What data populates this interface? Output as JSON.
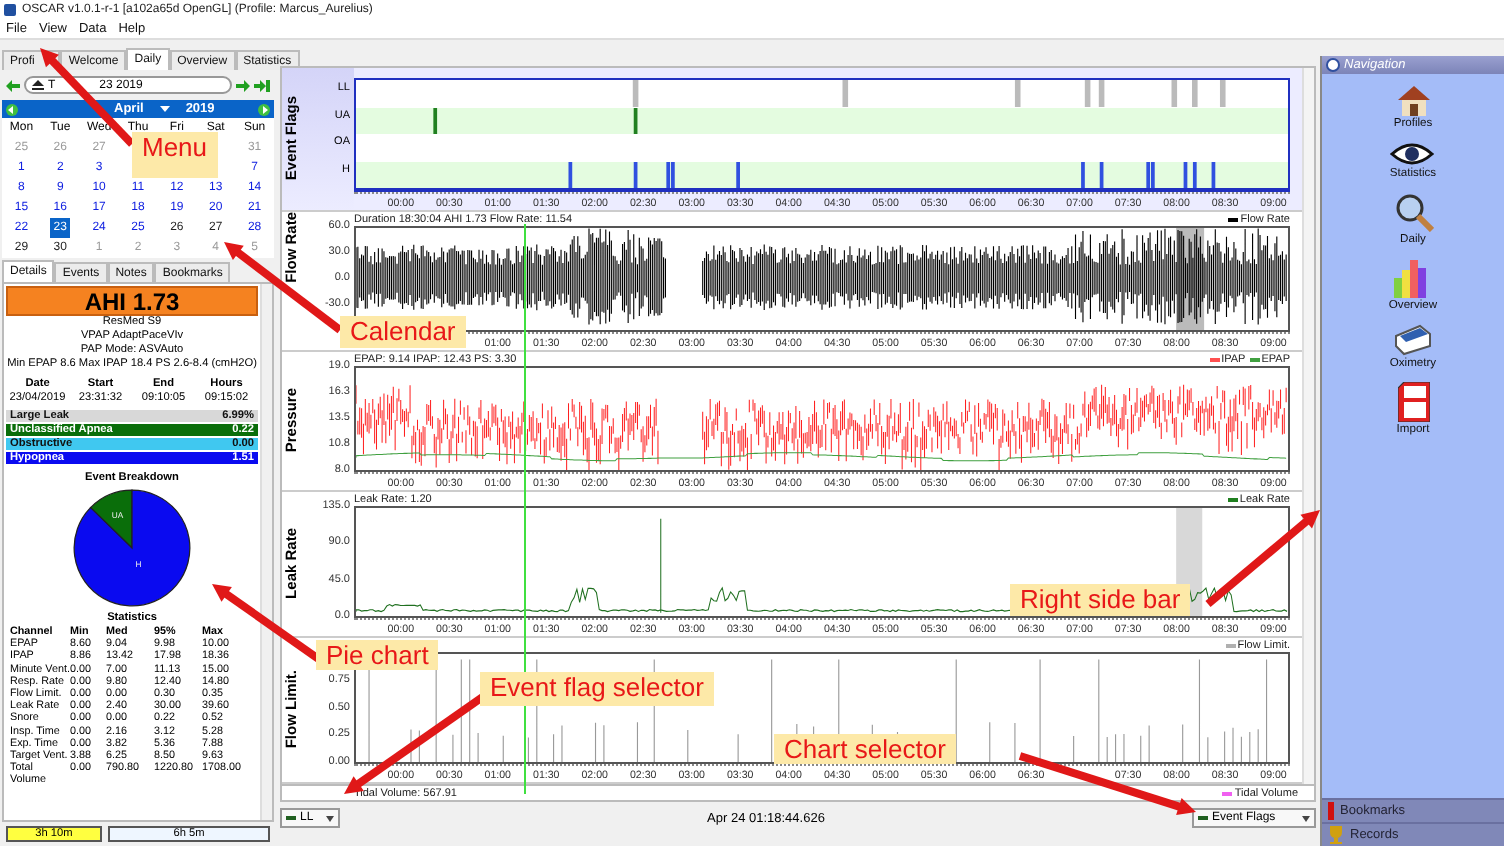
{
  "window": {
    "title": "OSCAR v1.0.1-r-1 [a102a65d OpenGL] (Profile: Marcus_Aurelius)"
  },
  "menu": [
    "File",
    "View",
    "Data",
    "Help"
  ],
  "tabs": [
    {
      "label": "Profi",
      "selected": false
    },
    {
      "label": "Welcome",
      "selected": false
    },
    {
      "label": "Daily",
      "selected": true
    },
    {
      "label": "Overview",
      "selected": false
    },
    {
      "label": "Statistics",
      "selected": false
    }
  ],
  "date_nav": {
    "value_parts": [
      "T",
      "23 2019"
    ]
  },
  "calendar": {
    "month": "April",
    "year": "2019",
    "weekdays": [
      "Mon",
      "Tue",
      "Wed",
      "Thu",
      "Fri",
      "Sat",
      "Sun"
    ],
    "weeks": [
      [
        {
          "day": "25",
          "other_month": true,
          "selected": false
        },
        {
          "day": "26",
          "other_month": true,
          "selected": false
        },
        {
          "day": "27",
          "other_month": true,
          "selected": false
        },
        {
          "day": "31",
          "other_month": true,
          "selected": false
        }
      ],
      [
        {
          "day": "1",
          "other_month": false,
          "has_data": true,
          "selected": false
        },
        {
          "day": "2",
          "other_month": false,
          "has_data": true,
          "selected": false
        },
        {
          "day": "3",
          "other_month": false,
          "has_data": true,
          "selected": false
        },
        {
          "day": "7",
          "other_month": false,
          "has_data": true,
          "selected": false
        }
      ],
      [
        {
          "day": "8",
          "other_month": false,
          "has_data": true,
          "selected": false
        },
        {
          "day": "9",
          "other_month": false,
          "has_data": true,
          "selected": false
        },
        {
          "day": "10",
          "other_month": false,
          "has_data": true,
          "selected": false
        },
        {
          "day": "11",
          "other_month": false,
          "has_data": true,
          "selected": false
        },
        {
          "day": "12",
          "other_month": false,
          "has_data": true,
          "selected": false
        },
        {
          "day": "13",
          "other_month": false,
          "has_data": true,
          "selected": false
        },
        {
          "day": "14",
          "other_month": false,
          "has_data": true,
          "selected": false
        }
      ],
      [
        {
          "day": "15",
          "other_month": false,
          "has_data": true,
          "selected": false
        },
        {
          "day": "16",
          "other_month": false,
          "has_data": true,
          "selected": false
        },
        {
          "day": "17",
          "other_month": false,
          "has_data": true,
          "selected": false
        },
        {
          "day": "18",
          "other_month": false,
          "has_data": true,
          "selected": false
        },
        {
          "day": "19",
          "other_month": false,
          "has_data": true,
          "selected": false
        },
        {
          "day": "20",
          "other_month": false,
          "has_data": true,
          "selected": false
        },
        {
          "day": "21",
          "other_month": false,
          "has_data": true,
          "selected": false
        }
      ],
      [
        {
          "day": "22",
          "other_month": false,
          "has_data": true,
          "selected": false
        },
        {
          "day": "23",
          "other_month": false,
          "has_data": true,
          "selected": true
        },
        {
          "day": "24",
          "other_month": false,
          "has_data": true,
          "selected": false
        },
        {
          "day": "25",
          "other_month": false,
          "has_data": true,
          "selected": false
        },
        {
          "day": "26",
          "other_month": false,
          "has_data": false,
          "selected": false
        },
        {
          "day": "27",
          "other_month": false,
          "has_data": false,
          "selected": false
        },
        {
          "day": "28",
          "other_month": false,
          "has_data": true,
          "selected": false
        }
      ],
      [
        {
          "day": "29",
          "other_month": false,
          "has_data": false,
          "selected": false
        },
        {
          "day": "30",
          "other_month": false,
          "has_data": false,
          "selected": false
        },
        {
          "day": "1",
          "other_month": true,
          "selected": false
        },
        {
          "day": "2",
          "other_month": true,
          "selected": false
        },
        {
          "day": "3",
          "other_month": true,
          "selected": false
        },
        {
          "day": "4",
          "other_month": true,
          "selected": false
        },
        {
          "day": "5",
          "other_month": true,
          "selected": false
        }
      ]
    ]
  },
  "detail_tabs": [
    {
      "label": "Details",
      "selected": true
    },
    {
      "label": "Events",
      "selected": false
    },
    {
      "label": "Notes",
      "selected": false
    },
    {
      "label": "Bookmarks",
      "selected": false
    }
  ],
  "ahi": "AHI 1.73",
  "device_info": [
    "ResMed S9",
    "VPAP AdaptPaceVIv",
    "PAP Mode: ASVAuto",
    "Min EPAP 8.6 Max IPAP 18.4 PS 2.6-8.4 (cmH2O)"
  ],
  "session": {
    "columns": [
      "Date",
      "Start",
      "End",
      "Hours"
    ],
    "values": [
      "23/04/2019",
      "23:31:32",
      "09:10:05",
      "09:15:02"
    ]
  },
  "events": [
    {
      "name": "Large Leak",
      "value": "6.99%",
      "color": "#d8d8d8"
    },
    {
      "name": "Unclassified Apnea",
      "value": "0.22",
      "color": "#0a6e0a",
      "pie_label": "UA"
    },
    {
      "name": "Obstructive",
      "value": "0.00",
      "color": "#40c8f0"
    },
    {
      "name": "Hypopnea",
      "value": "1.51",
      "color": "#0a0af0",
      "pie_label": "H"
    }
  ],
  "event_breakdown": {
    "title": "Event Breakdown"
  },
  "statistics": {
    "title": "Statistics",
    "columns": [
      "Channel",
      "Min",
      "Med",
      "95%",
      "Max"
    ],
    "rows": [
      [
        "EPAP",
        "8.60",
        "9.04",
        "9.98",
        "10.00"
      ],
      [
        "IPAP",
        "8.86",
        "13.42",
        "17.98",
        "18.36"
      ],
      [
        "Minute Vent.",
        "0.00",
        "7.00",
        "11.13",
        "15.00"
      ],
      [
        "Resp. Rate",
        "0.00",
        "9.80",
        "12.40",
        "14.80"
      ],
      [
        "Flow Limit.",
        "0.00",
        "0.00",
        "0.30",
        "0.35"
      ],
      [
        "Leak Rate",
        "0.00",
        "2.40",
        "30.00",
        "39.60"
      ],
      [
        "Snore",
        "0.00",
        "0.00",
        "0.22",
        "0.52"
      ],
      [
        "Insp. Time",
        "0.00",
        "2.16",
        "3.12",
        "5.28"
      ],
      [
        "Exp. Time",
        "0.00",
        "3.82",
        "5.36",
        "7.88"
      ],
      [
        "Target Vent.",
        "3.88",
        "6.25",
        "8.50",
        "9.63"
      ],
      [
        "Total Volume",
        "0.00",
        "790.80",
        "1220.80",
        "1708.00"
      ]
    ]
  },
  "durations": [
    {
      "label": "3h 10m",
      "highlighted": true
    },
    {
      "label": "6h 5m",
      "highlighted": false
    }
  ],
  "graphs": [
    {
      "kind": "flags",
      "title": "Event Flags",
      "rows": [
        "LL",
        "UA",
        "OA",
        "H"
      ],
      "xticks": [
        "00:00",
        "00:30",
        "01:00",
        "01:30",
        "02:00",
        "02:30",
        "03:00",
        "03:30",
        "04:00",
        "04:30",
        "05:00",
        "05:30",
        "06:00",
        "06:30",
        "07:00",
        "07:30",
        "08:00",
        "08:30",
        "09:00"
      ]
    },
    {
      "kind": "flow",
      "title": "Flow Rate",
      "info": "Duration 18:30:04 AHI 1.73 Flow Rate: 11.54",
      "legend": [
        {
          "label": "Flow Rate",
          "color": "#000000"
        }
      ],
      "yticks": [
        "60.0",
        "30.0",
        "0.0",
        "-30.0"
      ],
      "xticks": [
        "01:00",
        "01:30",
        "02:00",
        "02:30",
        "03:00",
        "03:30",
        "04:00",
        "04:30",
        "05:00",
        "05:30",
        "06:00",
        "06:30",
        "07:00",
        "07:30",
        "08:00",
        "08:30",
        "09:00"
      ]
    },
    {
      "kind": "pressure",
      "title": "Pressure",
      "info": "EPAP: 9.14 IPAP: 12.43 PS: 3.30",
      "legend": [
        {
          "label": "IPAP",
          "color": "#ff5050"
        },
        {
          "label": "EPAP",
          "color": "#40a040"
        }
      ],
      "yticks": [
        "19.0",
        "16.3",
        "13.5",
        "10.8",
        "8.0"
      ],
      "xticks": [
        "00:00",
        "00:30",
        "01:00",
        "01:30",
        "02:00",
        "02:30",
        "03:00",
        "03:30",
        "04:00",
        "04:30",
        "05:00",
        "05:30",
        "06:00",
        "06:30",
        "07:00",
        "07:30",
        "08:00",
        "08:30",
        "09:00"
      ]
    },
    {
      "kind": "leak",
      "title": "Leak Rate",
      "info": "Leak Rate: 1.20",
      "legend": [
        {
          "label": "Leak Rate",
          "color": "#208020"
        }
      ],
      "yticks": [
        "135.0",
        "90.0",
        "45.0",
        "0.0"
      ],
      "xticks": [
        "00:00",
        "00:30",
        "01:00",
        "01:30",
        "02:00",
        "02:30",
        "03:00",
        "03:30",
        "04:00",
        "04:30",
        "05:00",
        "05:30",
        "06:00",
        "06:30",
        "07:00",
        "07:30",
        "08:00",
        "08:30",
        "09:00"
      ]
    },
    {
      "kind": "flowlimit",
      "title": "Flow Limit.",
      "legend": [
        {
          "label": "Flow Limit.",
          "color": "#b0b0b0"
        }
      ],
      "yticks": [
        "0.75",
        "0.50",
        "0.25",
        "0.00"
      ],
      "xticks": [
        "00:00",
        "00:30",
        "01:00",
        "01:30",
        "02:00",
        "02:30",
        "03:00",
        "03:30",
        "04:00",
        "04:30",
        "05:00",
        "05:30",
        "06:00",
        "06:30",
        "07:30",
        "08:00",
        "08:30",
        "09:00"
      ]
    }
  ],
  "tidal": {
    "info": "Tidal Volume: 567.91",
    "legend": {
      "label": "Tidal Volume",
      "color": "#f060f0"
    }
  },
  "bottom_bar": {
    "event_selector": "LL",
    "time": "Apr 24 01:18:44.626",
    "chart_selector": "Event Flags"
  },
  "navigation": {
    "title": "Navigation",
    "items": [
      {
        "label": "Profiles",
        "kind": "house"
      },
      {
        "label": "Statistics",
        "kind": "eye"
      },
      {
        "label": "Daily",
        "kind": "magnifier"
      },
      {
        "label": "Overview",
        "kind": "bars"
      },
      {
        "label": "Oximetry",
        "kind": "oximeter"
      },
      {
        "label": "Import",
        "kind": "sdcard"
      }
    ],
    "sections": [
      {
        "label": "Bookmarks",
        "kind": "bookmark"
      },
      {
        "label": "Records",
        "kind": "trophy"
      }
    ]
  },
  "callouts": [
    {
      "label": "Menu"
    },
    {
      "label": "Calendar"
    },
    {
      "label": "Pie chart"
    },
    {
      "label": "Event flag selector"
    },
    {
      "label": "Right side bar"
    },
    {
      "label": "Chart selector"
    }
  ]
}
